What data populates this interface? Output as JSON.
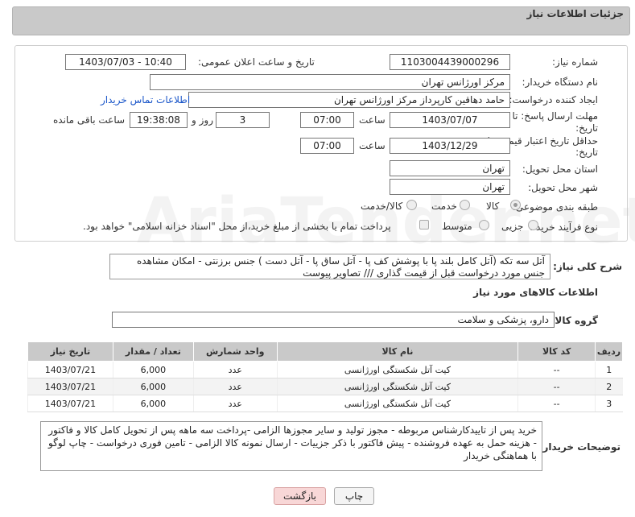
{
  "header": {
    "title": "جزئیات اطلاعات نیاز"
  },
  "form": {
    "need_number_label": "شماره نیاز:",
    "need_number": "1103004439000296",
    "announce_label": "تاریخ و ساعت اعلان عمومی:",
    "announce_value": "1403/07/03 - 10:40",
    "buyer_org_label": "نام دستگاه خریدار:",
    "buyer_org": "مرکز اورژانس تهران",
    "creator_label": "ایجاد کننده درخواست:",
    "creator": "حامد دهاقین کارپرداز مرکز اورژانس تهران",
    "contact_link": "اطلاعات تماس خریدار",
    "reply_deadline_label_1": "مهلت ارسال پاسخ: تا",
    "reply_deadline_label_2": "تاریخ:",
    "reply_date": "1403/07/07",
    "time_label": "ساعت",
    "reply_time": "07:00",
    "days": "3",
    "days_label": "روز و",
    "remaining_time": "19:38:08",
    "remaining_label": "ساعت باقی مانده",
    "validity_label_1": "حداقل تاریخ اعتبار قیمت: تا",
    "validity_label_2": "تاریخ:",
    "validity_date": "1403/12/29",
    "validity_time": "07:00",
    "province_label": "استان محل تحویل:",
    "province": "تهران",
    "city_label": "شهر محل تحویل:",
    "city": "تهران",
    "category_label": "طبقه بندی موضوعی:",
    "category_options": [
      "کالا",
      "خدمت",
      "کالا/خدمت"
    ],
    "process_label": "نوع فرآیند خرید :",
    "process_options": [
      "جزیی",
      "متوسط"
    ],
    "payment_note": "پرداخت تمام یا بخشی از مبلغ خرید،از محل \"اسناد خزانه اسلامی\" خواهد بود."
  },
  "description": {
    "label": "شرح کلی نیاز:",
    "text": "آتل سه تکه (آتل کامل بلند پا با پوشش کف پا - آتل ساق پا - آتل دست ) جنس برزنتی - امکان مشاهده جنس مورد درخواست قبل از قیمت گذاری /// تصاویر پیوست"
  },
  "goods": {
    "section_title": "اطلاعات کالاهای مورد نیاز",
    "group_label": "گروه کالا:",
    "group_value": "دارو، پزشکی و سلامت",
    "columns": [
      "ردیف",
      "کد کالا",
      "نام کالا",
      "واحد شمارش",
      "تعداد / مقدار",
      "تاریخ نیاز"
    ],
    "rows": [
      [
        "1",
        "--",
        "کیت آتل شکستگی اورژانسی",
        "عدد",
        "6,000",
        "1403/07/21"
      ],
      [
        "2",
        "--",
        "کیت آتل شکستگی اورژانسی",
        "عدد",
        "6,000",
        "1403/07/21"
      ],
      [
        "3",
        "--",
        "کیت آتل شکستگی اورژانسی",
        "عدد",
        "6,000",
        "1403/07/21"
      ]
    ]
  },
  "buyer_notes": {
    "label": "توضیحات خریدار:",
    "text": "خرید پس از تاییدکارشناس مربوطه - مجوز تولید و سایر مجوزها الزامی -پرداخت سه ماهه پس از تحویل کامل کالا و فاکتور - هزینه حمل به عهده فروشنده - پیش فاکتور با ذکر جزییات - ارسال نمونه کالا الزامی - تامین فوری درخواست - چاپ لوگو با هماهنگی خریدار"
  },
  "buttons": {
    "print": "چاپ",
    "back": "بازگشت"
  },
  "watermark": "AriaTender.net"
}
